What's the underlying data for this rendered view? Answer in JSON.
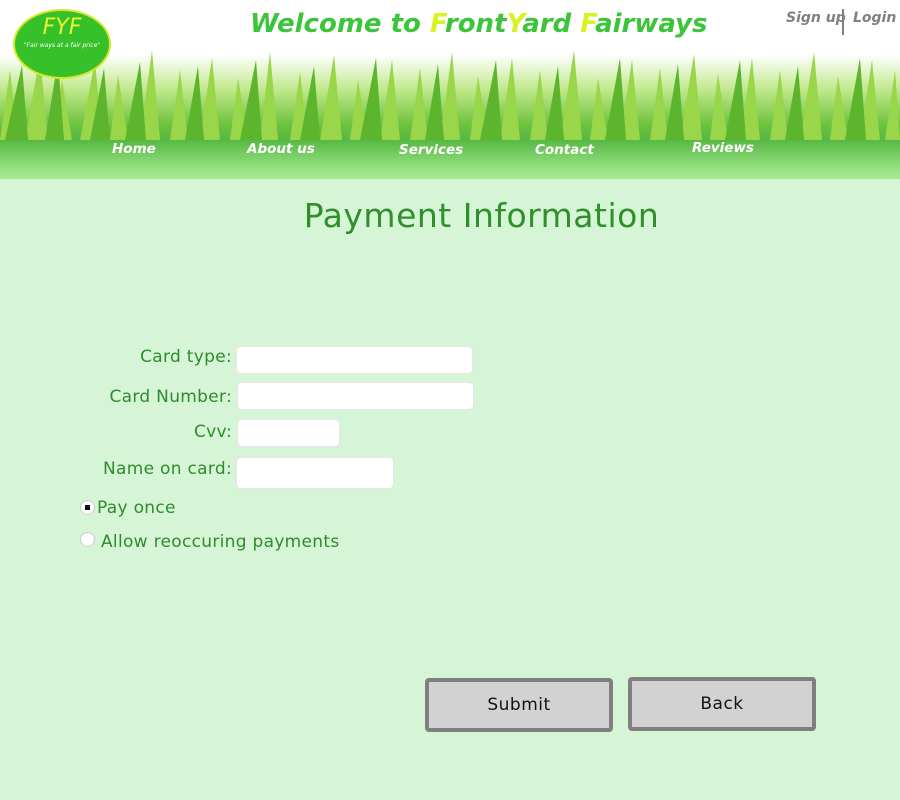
{
  "logo": {
    "title": "FYF",
    "tagline": "\"Fair ways at a fair price\""
  },
  "site_title": {
    "part1": "Welcome to ",
    "f1": "F",
    "part2": "ront",
    "y": "Y",
    "part3": "ard ",
    "f2": "F",
    "part4": "airways"
  },
  "auth": {
    "signup": "Sign up",
    "login": "Login"
  },
  "nav": {
    "home": "Home",
    "about": "About us",
    "services": "Services",
    "contact": "Contact",
    "reviews": "Reviews"
  },
  "page_title": "Payment Information",
  "form": {
    "card_type_label": "Card type:",
    "card_number_label": "Card Number:",
    "cvv_label": "Cvv:",
    "name_label": "Name on card:",
    "card_type_value": "",
    "card_number_value": "",
    "cvv_value": "",
    "name_value": "",
    "pay_once_label": "Pay once",
    "recurring_label": "Allow reoccuring payments",
    "selected": "pay_once"
  },
  "buttons": {
    "submit": "Submit",
    "back": "Back"
  },
  "colors": {
    "background": "#d6f5d6",
    "text_green": "#2e8b2e",
    "title_green": "#3cc43a",
    "highlight_yellow": "#dbf221"
  }
}
